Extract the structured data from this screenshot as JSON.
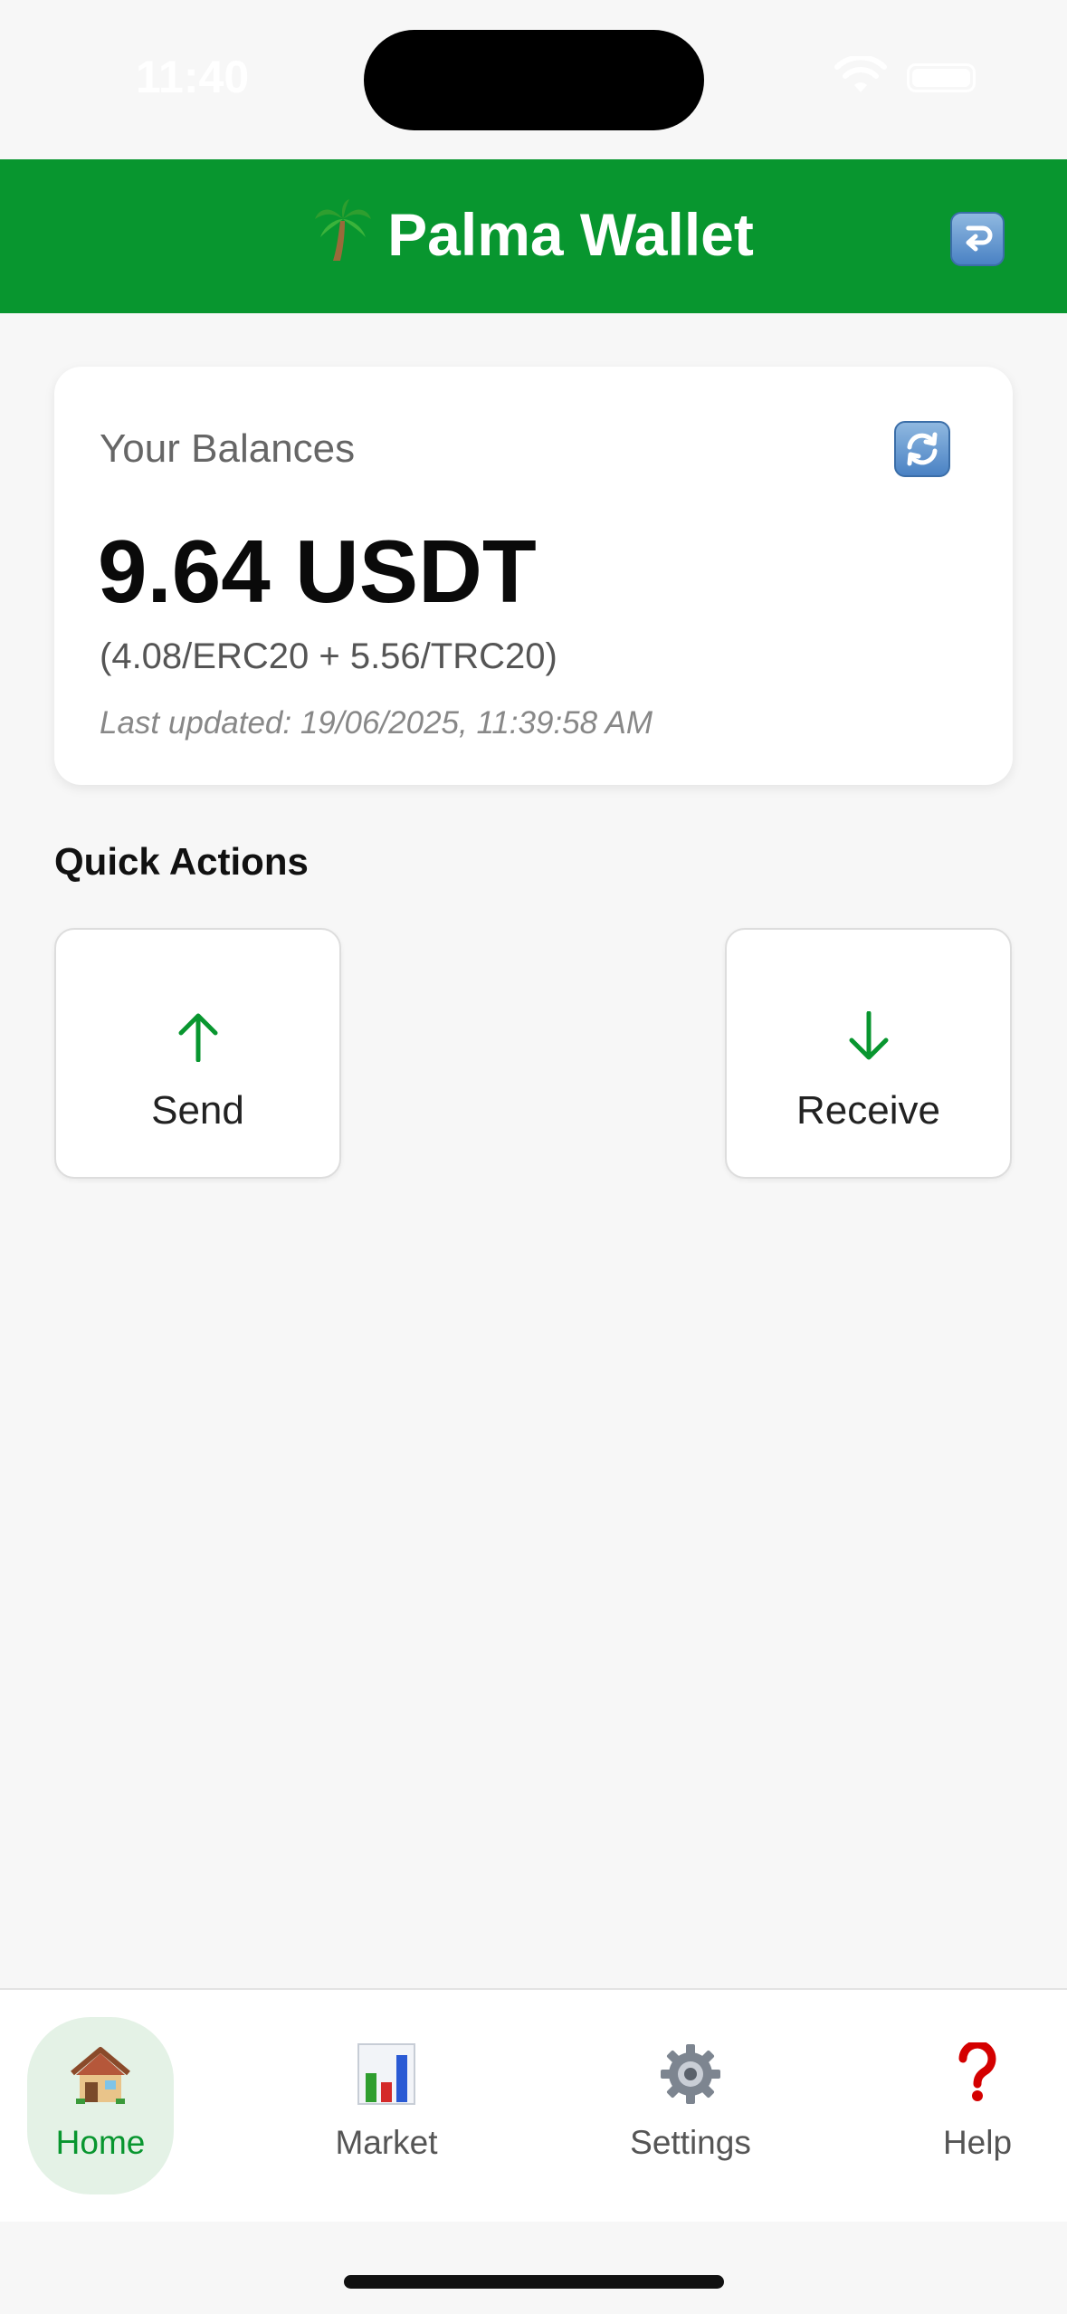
{
  "status_bar": {
    "time": "11:40"
  },
  "header": {
    "title": "Palma Wallet",
    "title_icon": "palm-tree-icon",
    "action_icon": "logout-icon",
    "color": "#08962f"
  },
  "balance_card": {
    "label": "Your Balances",
    "amount": "9.64 USDT",
    "breakdown": "(4.08/ERC20 + 5.56/TRC20)",
    "last_updated": "Last updated: 19/06/2025, 11:39:58 AM",
    "refresh_icon": "refresh-icon"
  },
  "quick_actions": {
    "title": "Quick Actions",
    "items": [
      {
        "label": "Send",
        "icon": "arrow-up-icon"
      },
      {
        "label": "Receive",
        "icon": "arrow-down-icon"
      }
    ]
  },
  "tabs": [
    {
      "label": "Home",
      "icon": "home-icon",
      "active": true
    },
    {
      "label": "Market",
      "icon": "bar-chart-icon",
      "active": false
    },
    {
      "label": "Settings",
      "icon": "gear-icon",
      "active": false
    },
    {
      "label": "Help",
      "icon": "question-mark-icon",
      "active": false
    }
  ],
  "colors": {
    "accent": "#08962f",
    "background": "#f7f7f7",
    "card": "#ffffff"
  }
}
